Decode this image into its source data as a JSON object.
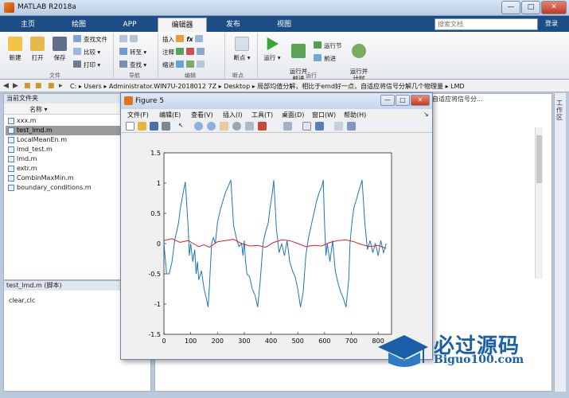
{
  "window": {
    "title": "MATLAB R2018a",
    "min": "—",
    "max": "□",
    "close": "✕"
  },
  "tabs": [
    "主页",
    "绘图",
    "APP",
    "编辑器",
    "发布",
    "视图"
  ],
  "active_tab": "编辑器",
  "search": {
    "placeholder": "搜索文档"
  },
  "login": "登录",
  "ribbon": {
    "file": {
      "new": "新建",
      "open": "打开",
      "save": "保存",
      "find_files": "查找文件",
      "compare": "比较",
      "print": "打印",
      "section": "文件"
    },
    "nav": {
      "goto": "转至",
      "find": "查找",
      "section": "导航"
    },
    "edit": {
      "insert": "插入",
      "comment": "注释",
      "indent": "缩进",
      "fx": "fx",
      "section": "编辑"
    },
    "breakpoints": {
      "label": "断点",
      "section": "断点"
    },
    "run": {
      "run": "运行",
      "run_advance": "运行并\n前进",
      "run_section": "运行节",
      "advance": "前进",
      "run_time": "运行并\n计时",
      "section": "运行"
    }
  },
  "address": {
    "path": "C: ▸ Users ▸ Administrator.WIN7U-2018012 7Z ▸ Desktop ▸ 局部均值分解，相比于emd好一点，自适应将信号分解几个物理量 ▸ LMD"
  },
  "left_panel": {
    "header": "当前文件夹",
    "column": "名称 ▾",
    "files": [
      "xxx.m",
      "test_lmd.m",
      "LocalMeanEn.m",
      "lmd_test.m",
      "lmd.m",
      "extr.m",
      "CombinMaxMin.m",
      "boundary_conditions.m"
    ],
    "selected": "test_lmd.m"
  },
  "detail": {
    "header": "test_lmd.m  (脚本)",
    "content": "clear,clc"
  },
  "editor_tab": "自适应将信号分...",
  "right_strip": "工作区",
  "figure": {
    "title": "Figure 5",
    "menus": [
      "文件(F)",
      "编辑(E)",
      "查看(V)",
      "插入(I)",
      "工具(T)",
      "桌面(D)",
      "窗口(W)",
      "帮助(H)"
    ]
  },
  "watermark": {
    "cn": "必过源码",
    "en": "Biguo100.com"
  },
  "colors": {
    "blue_series": "#1f77b4",
    "red_series": "#e0202a",
    "matlab_blue": "#1c4d84"
  },
  "chart_data": {
    "type": "line",
    "xlim": [
      0,
      850
    ],
    "ylim": [
      -1.5,
      1.5
    ],
    "xticks": [
      0,
      100,
      200,
      300,
      400,
      500,
      600,
      700,
      800
    ],
    "yticks": [
      -1.5,
      -1,
      -0.5,
      0,
      0.5,
      1,
      1.5
    ],
    "grid": false,
    "series": [
      {
        "color": "#1f77b4",
        "x": [
          0,
          10,
          20,
          30,
          40,
          55,
          60,
          70,
          80,
          90,
          95,
          100,
          108,
          115,
          120,
          125,
          130,
          140,
          150,
          158,
          165,
          170,
          178,
          185,
          192,
          200,
          210,
          220,
          230,
          240,
          250,
          260,
          270,
          280,
          290,
          295,
          300,
          305,
          310,
          320,
          330,
          340,
          350,
          360,
          370,
          380,
          390,
          395,
          400,
          405,
          410,
          420,
          430,
          440,
          450,
          460,
          470,
          480,
          490,
          500,
          505,
          510,
          520,
          530,
          540,
          550,
          560,
          570,
          580,
          590,
          595,
          600,
          605,
          610,
          620,
          630,
          640,
          650,
          660,
          670,
          680,
          690,
          695,
          700,
          705,
          710,
          720,
          730,
          740,
          750,
          760,
          770,
          780,
          790,
          800,
          810,
          820,
          830
        ],
        "y": [
          0,
          -0.5,
          -0.5,
          -0.3,
          0.05,
          0.35,
          0.55,
          0.8,
          1.02,
          0.3,
          -0.2,
          0.0,
          -0.3,
          -0.1,
          -0.5,
          -0.3,
          -0.6,
          -0.45,
          -0.75,
          -0.9,
          -1.05,
          -0.7,
          0.0,
          0.1,
          0.0,
          0.35,
          0.55,
          0.7,
          0.85,
          0.95,
          1.05,
          0.3,
          0.1,
          -0.05,
          0.0,
          -0.2,
          0.05,
          -0.3,
          -0.5,
          -0.55,
          -0.75,
          -0.85,
          -1.05,
          -0.6,
          0.0,
          0.2,
          0.35,
          0.55,
          0.7,
          0.85,
          1.05,
          0.25,
          -0.15,
          0.0,
          -0.2,
          0.05,
          -0.3,
          -0.45,
          -0.55,
          -0.75,
          -0.9,
          -1.05,
          -0.8,
          -0.2,
          0.1,
          0.3,
          0.5,
          0.7,
          0.85,
          0.95,
          1.05,
          0.3,
          -0.2,
          0.0,
          -0.3,
          0.05,
          -0.45,
          -0.65,
          -0.8,
          -0.9,
          -1.05,
          -0.6,
          0.0,
          0.25,
          0.45,
          0.6,
          0.75,
          0.9,
          1.05,
          0.35,
          -0.1,
          0.05,
          -0.15,
          0.0,
          -0.2,
          0.05,
          -0.15,
          0.0
        ]
      },
      {
        "color": "#e0202a",
        "x": [
          0,
          30,
          60,
          90,
          110,
          130,
          150,
          170,
          200,
          230,
          260,
          290,
          320,
          350,
          380,
          410,
          440,
          470,
          500,
          530,
          560,
          590,
          620,
          650,
          680,
          710,
          740,
          770,
          800,
          830
        ],
        "y": [
          0.05,
          0.08,
          0.02,
          0.05,
          0.0,
          -0.05,
          -0.02,
          -0.06,
          0.03,
          0.05,
          0.07,
          0.0,
          -0.04,
          -0.03,
          -0.06,
          0.02,
          0.06,
          0.05,
          0.0,
          -0.05,
          -0.03,
          -0.04,
          0.02,
          0.05,
          0.06,
          0.03,
          -0.02,
          -0.05,
          -0.03,
          -0.08
        ]
      }
    ]
  }
}
